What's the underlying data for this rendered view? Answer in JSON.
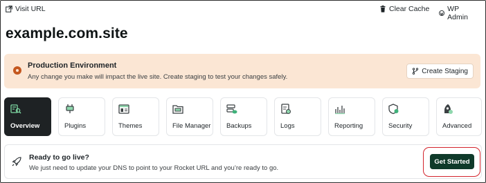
{
  "topbar": {
    "visit_url": "Visit URL",
    "clear_cache": "Clear Cache",
    "wp_admin": "WP Admin"
  },
  "site": {
    "title": "example.com.site"
  },
  "banner": {
    "title": "Production Environment",
    "text": "Any change you make will impact the live site. Create staging to test your changes safely.",
    "button": "Create Staging"
  },
  "tiles": [
    {
      "label": "Overview",
      "icon": "overview-icon",
      "active": true
    },
    {
      "label": "Plugins",
      "icon": "plugin-icon"
    },
    {
      "label": "Themes",
      "icon": "themes-icon"
    },
    {
      "label": "File Manager",
      "icon": "folder-icon"
    },
    {
      "label": "Backups",
      "icon": "backup-icon"
    },
    {
      "label": "Logs",
      "icon": "logs-icon"
    },
    {
      "label": "Reporting",
      "icon": "reporting-icon"
    },
    {
      "label": "Security",
      "icon": "shield-icon"
    },
    {
      "label": "Advanced",
      "icon": "advanced-icon"
    }
  ],
  "golive": {
    "title": "Ready to go live?",
    "text": "We just need to update your DNS to point to your Rocket URL and you’re ready to go.",
    "button": "Get Started"
  },
  "colors": {
    "accent_green": "#3f9d6b",
    "banner_bg": "#fbe6d4",
    "banner_dot": "#c4571f",
    "cta_bg": "#0f3a2a",
    "highlight": "#d3232b"
  }
}
